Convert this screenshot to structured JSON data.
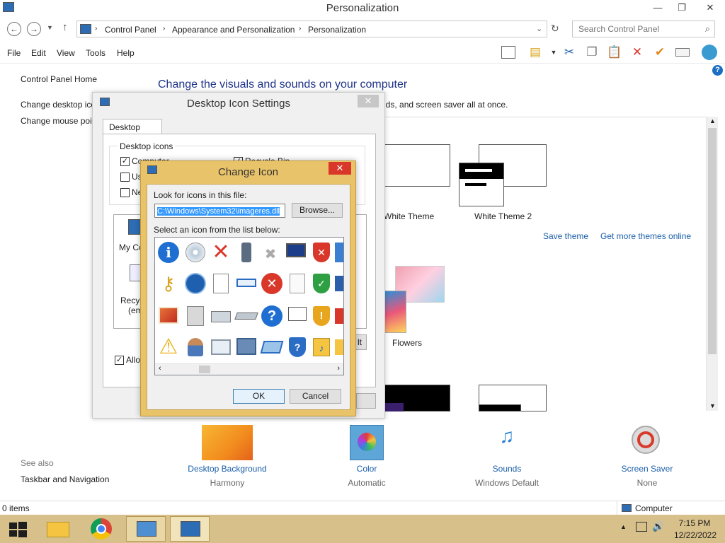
{
  "window": {
    "title": "Personalization",
    "controls": {
      "minimize": "—",
      "restore": "❐",
      "close": "✕"
    }
  },
  "address": {
    "crumbs": [
      "Control Panel",
      "Appearance and Personalization",
      "Personalization"
    ],
    "search_placeholder": "Search Control Panel"
  },
  "menu": [
    "File",
    "Edit",
    "View",
    "Tools",
    "Help"
  ],
  "left_pane": {
    "home": "Control Panel Home",
    "links": [
      "Change desktop icons",
      "Change mouse pointers"
    ],
    "see_also_label": "See also",
    "see_also": [
      "Taskbar and Navigation"
    ]
  },
  "content": {
    "heading": "Change the visuals and sounds on your computer",
    "subheading": "nds, and screen saver all at once.",
    "themes": [
      "White Theme",
      "White Theme 2",
      "Flowers"
    ],
    "save_theme": "Save theme",
    "get_more": "Get more themes online"
  },
  "bottom_items": [
    {
      "title": "Desktop Background",
      "subtitle": "Harmony"
    },
    {
      "title": "Color",
      "subtitle": "Automatic"
    },
    {
      "title": "Sounds",
      "subtitle": "Windows Default"
    },
    {
      "title": "Screen Saver",
      "subtitle": "None"
    }
  ],
  "status": {
    "items": "0 items",
    "location": "Computer"
  },
  "desktop_icon_settings": {
    "title": "Desktop Icon Settings",
    "tab": "Desktop Icons",
    "group_label": "Desktop icons",
    "checkboxes": [
      {
        "label": "Computer",
        "checked": true
      },
      {
        "label": "Recycle Bin",
        "checked": true
      },
      {
        "label": "Us",
        "checked": false
      },
      {
        "label": "Ne",
        "checked": false
      }
    ],
    "icon_labels": [
      "My Co",
      "Recyc",
      "(em"
    ],
    "allow_label": "Allow",
    "allow_checked": true
  },
  "change_icon": {
    "title": "Change Icon",
    "look_label": "Look for icons in this file:",
    "file_value": "C:\\Windows\\System32\\imageres.dll",
    "browse": "Browse...",
    "select_label": "Select an icon from the list below:",
    "ok": "OK",
    "cancel": "Cancel"
  },
  "clock": {
    "time": "7:15 PM",
    "date": "12/22/2022"
  },
  "colors": {
    "link": "#1a5ea8",
    "heading": "#1e3287",
    "taskbar": "#d7c08a",
    "dialog_frame": "#e9c36a",
    "close_red": "#d9372a"
  }
}
